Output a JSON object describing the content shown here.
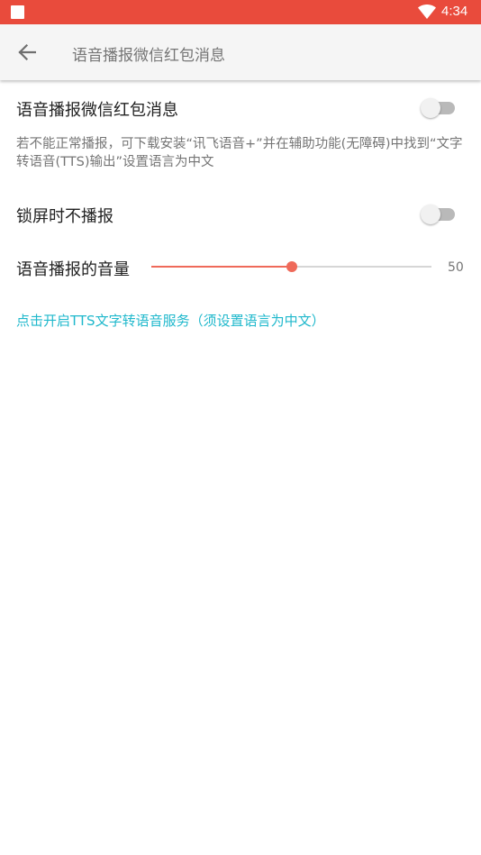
{
  "status_bar": {
    "time": "4:34",
    "icons": [
      "notification-square-icon",
      "wifi-icon"
    ],
    "background_color": "#e94b3c"
  },
  "app_bar": {
    "back_icon": "arrow-back-icon",
    "title": "语音播报微信红包消息"
  },
  "settings": {
    "voice_broadcast": {
      "title": "语音播报微信红包消息",
      "enabled": false,
      "description": "若不能正常播报，可下载安装“讯飞语音+”并在辅助功能(无障碍)中找到“文字转语音(TTS)输出”设置语言为中文"
    },
    "lock_screen": {
      "title": "锁屏时不播报",
      "enabled": false
    },
    "volume": {
      "title": "语音播报的音量",
      "value": 50,
      "value_label": "50",
      "max": 100,
      "accent_color": "#ef6a5a"
    }
  },
  "tts_link": {
    "label": "点击开启TTS文字转语音服务（须设置语言为中文）",
    "color": "#1fb8cc"
  }
}
